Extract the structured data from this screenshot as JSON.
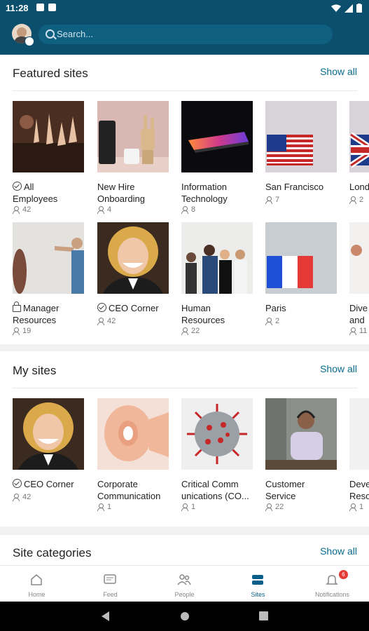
{
  "status_bar": {
    "time": "11:28"
  },
  "search": {
    "placeholder": "Search..."
  },
  "featured": {
    "title": "Featured sites",
    "show_all": "Show all",
    "row1": [
      {
        "name": "All Employees",
        "line1": "All",
        "line2": "Employees",
        "members": "42",
        "icon": "check"
      },
      {
        "name": "New Hire Onboarding",
        "line1": "New Hire",
        "line2": "Onboarding",
        "members": "4",
        "icon": ""
      },
      {
        "name": "Information Technology",
        "line1": "Information",
        "line2": "Technology",
        "members": "8",
        "icon": ""
      },
      {
        "name": "San Francisco",
        "line1": "San Francisco",
        "line2": "",
        "members": "7",
        "icon": ""
      },
      {
        "name": "London",
        "line1": "Lond",
        "line2": "",
        "members": "2",
        "icon": ""
      }
    ],
    "row2": [
      {
        "name": "Manager Resources",
        "line1": "Manager",
        "line2": "Resources",
        "members": "19",
        "icon": "lock"
      },
      {
        "name": "CEO Corner",
        "line1": "CEO Corner",
        "line2": "",
        "members": "42",
        "icon": "check"
      },
      {
        "name": "Human Resources",
        "line1": "Human",
        "line2": "Resources",
        "members": "22",
        "icon": ""
      },
      {
        "name": "Paris",
        "line1": "Paris",
        "line2": "",
        "members": "2",
        "icon": ""
      },
      {
        "name": "Diversity and",
        "line1": "Dive",
        "line2": "and",
        "members": "11",
        "icon": ""
      }
    ]
  },
  "my_sites": {
    "title": "My sites",
    "show_all": "Show all",
    "items": [
      {
        "name": "CEO Corner",
        "line1": "CEO Corner",
        "line2": "",
        "members": "42",
        "icon": "check"
      },
      {
        "name": "Corporate Communication",
        "line1": "Corporate",
        "line2": "Communication",
        "members": "1",
        "icon": ""
      },
      {
        "name": "Critical Communications",
        "line1": "Critical Comm",
        "line2": "unications (CO...",
        "members": "1",
        "icon": ""
      },
      {
        "name": "Customer Service",
        "line1": "Customer",
        "line2": "Service",
        "members": "22",
        "icon": ""
      },
      {
        "name": "Development Resources",
        "line1": "Deve",
        "line2": "Reso",
        "members": "1",
        "icon": ""
      }
    ]
  },
  "categories": {
    "title": "Site categories",
    "show_all": "Show all"
  },
  "bottom_nav": {
    "home": "Home",
    "feed": "Feed",
    "people": "People",
    "sites": "Sites",
    "notifications": "Notifications",
    "notification_count": "6"
  },
  "colors": {
    "header": "#0b4f6c",
    "accent": "#0b6a8c",
    "active_nav": "#0b5f8a",
    "badge": "#e53935"
  }
}
